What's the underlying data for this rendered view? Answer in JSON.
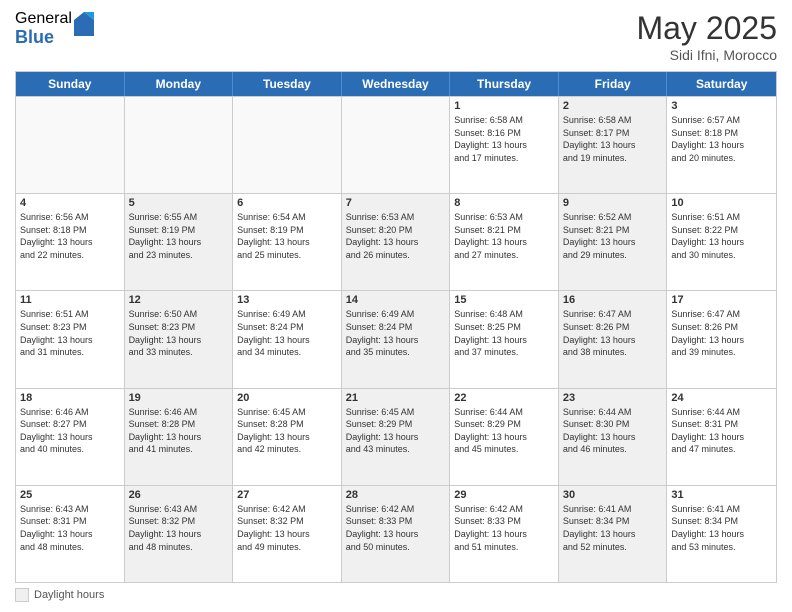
{
  "logo": {
    "general": "General",
    "blue": "Blue"
  },
  "title": "May 2025",
  "subtitle": "Sidi Ifni, Morocco",
  "dayHeaders": [
    "Sunday",
    "Monday",
    "Tuesday",
    "Wednesday",
    "Thursday",
    "Friday",
    "Saturday"
  ],
  "footer": {
    "box_label": "Daylight hours"
  },
  "weeks": [
    [
      {
        "num": "",
        "info": "",
        "empty": true
      },
      {
        "num": "",
        "info": "",
        "empty": true
      },
      {
        "num": "",
        "info": "",
        "empty": true
      },
      {
        "num": "",
        "info": "",
        "empty": true
      },
      {
        "num": "1",
        "info": "Sunrise: 6:58 AM\nSunset: 8:16 PM\nDaylight: 13 hours\nand 17 minutes.",
        "empty": false
      },
      {
        "num": "2",
        "info": "Sunrise: 6:58 AM\nSunset: 8:17 PM\nDaylight: 13 hours\nand 19 minutes.",
        "empty": false,
        "shaded": true
      },
      {
        "num": "3",
        "info": "Sunrise: 6:57 AM\nSunset: 8:18 PM\nDaylight: 13 hours\nand 20 minutes.",
        "empty": false
      }
    ],
    [
      {
        "num": "4",
        "info": "Sunrise: 6:56 AM\nSunset: 8:18 PM\nDaylight: 13 hours\nand 22 minutes.",
        "empty": false
      },
      {
        "num": "5",
        "info": "Sunrise: 6:55 AM\nSunset: 8:19 PM\nDaylight: 13 hours\nand 23 minutes.",
        "empty": false,
        "shaded": true
      },
      {
        "num": "6",
        "info": "Sunrise: 6:54 AM\nSunset: 8:19 PM\nDaylight: 13 hours\nand 25 minutes.",
        "empty": false
      },
      {
        "num": "7",
        "info": "Sunrise: 6:53 AM\nSunset: 8:20 PM\nDaylight: 13 hours\nand 26 minutes.",
        "empty": false,
        "shaded": true
      },
      {
        "num": "8",
        "info": "Sunrise: 6:53 AM\nSunset: 8:21 PM\nDaylight: 13 hours\nand 27 minutes.",
        "empty": false
      },
      {
        "num": "9",
        "info": "Sunrise: 6:52 AM\nSunset: 8:21 PM\nDaylight: 13 hours\nand 29 minutes.",
        "empty": false,
        "shaded": true
      },
      {
        "num": "10",
        "info": "Sunrise: 6:51 AM\nSunset: 8:22 PM\nDaylight: 13 hours\nand 30 minutes.",
        "empty": false
      }
    ],
    [
      {
        "num": "11",
        "info": "Sunrise: 6:51 AM\nSunset: 8:23 PM\nDaylight: 13 hours\nand 31 minutes.",
        "empty": false
      },
      {
        "num": "12",
        "info": "Sunrise: 6:50 AM\nSunset: 8:23 PM\nDaylight: 13 hours\nand 33 minutes.",
        "empty": false,
        "shaded": true
      },
      {
        "num": "13",
        "info": "Sunrise: 6:49 AM\nSunset: 8:24 PM\nDaylight: 13 hours\nand 34 minutes.",
        "empty": false
      },
      {
        "num": "14",
        "info": "Sunrise: 6:49 AM\nSunset: 8:24 PM\nDaylight: 13 hours\nand 35 minutes.",
        "empty": false,
        "shaded": true
      },
      {
        "num": "15",
        "info": "Sunrise: 6:48 AM\nSunset: 8:25 PM\nDaylight: 13 hours\nand 37 minutes.",
        "empty": false
      },
      {
        "num": "16",
        "info": "Sunrise: 6:47 AM\nSunset: 8:26 PM\nDaylight: 13 hours\nand 38 minutes.",
        "empty": false,
        "shaded": true
      },
      {
        "num": "17",
        "info": "Sunrise: 6:47 AM\nSunset: 8:26 PM\nDaylight: 13 hours\nand 39 minutes.",
        "empty": false
      }
    ],
    [
      {
        "num": "18",
        "info": "Sunrise: 6:46 AM\nSunset: 8:27 PM\nDaylight: 13 hours\nand 40 minutes.",
        "empty": false
      },
      {
        "num": "19",
        "info": "Sunrise: 6:46 AM\nSunset: 8:28 PM\nDaylight: 13 hours\nand 41 minutes.",
        "empty": false,
        "shaded": true
      },
      {
        "num": "20",
        "info": "Sunrise: 6:45 AM\nSunset: 8:28 PM\nDaylight: 13 hours\nand 42 minutes.",
        "empty": false
      },
      {
        "num": "21",
        "info": "Sunrise: 6:45 AM\nSunset: 8:29 PM\nDaylight: 13 hours\nand 43 minutes.",
        "empty": false,
        "shaded": true
      },
      {
        "num": "22",
        "info": "Sunrise: 6:44 AM\nSunset: 8:29 PM\nDaylight: 13 hours\nand 45 minutes.",
        "empty": false
      },
      {
        "num": "23",
        "info": "Sunrise: 6:44 AM\nSunset: 8:30 PM\nDaylight: 13 hours\nand 46 minutes.",
        "empty": false,
        "shaded": true
      },
      {
        "num": "24",
        "info": "Sunrise: 6:44 AM\nSunset: 8:31 PM\nDaylight: 13 hours\nand 47 minutes.",
        "empty": false
      }
    ],
    [
      {
        "num": "25",
        "info": "Sunrise: 6:43 AM\nSunset: 8:31 PM\nDaylight: 13 hours\nand 48 minutes.",
        "empty": false
      },
      {
        "num": "26",
        "info": "Sunrise: 6:43 AM\nSunset: 8:32 PM\nDaylight: 13 hours\nand 48 minutes.",
        "empty": false,
        "shaded": true
      },
      {
        "num": "27",
        "info": "Sunrise: 6:42 AM\nSunset: 8:32 PM\nDaylight: 13 hours\nand 49 minutes.",
        "empty": false
      },
      {
        "num": "28",
        "info": "Sunrise: 6:42 AM\nSunset: 8:33 PM\nDaylight: 13 hours\nand 50 minutes.",
        "empty": false,
        "shaded": true
      },
      {
        "num": "29",
        "info": "Sunrise: 6:42 AM\nSunset: 8:33 PM\nDaylight: 13 hours\nand 51 minutes.",
        "empty": false
      },
      {
        "num": "30",
        "info": "Sunrise: 6:41 AM\nSunset: 8:34 PM\nDaylight: 13 hours\nand 52 minutes.",
        "empty": false,
        "shaded": true
      },
      {
        "num": "31",
        "info": "Sunrise: 6:41 AM\nSunset: 8:34 PM\nDaylight: 13 hours\nand 53 minutes.",
        "empty": false
      }
    ]
  ]
}
